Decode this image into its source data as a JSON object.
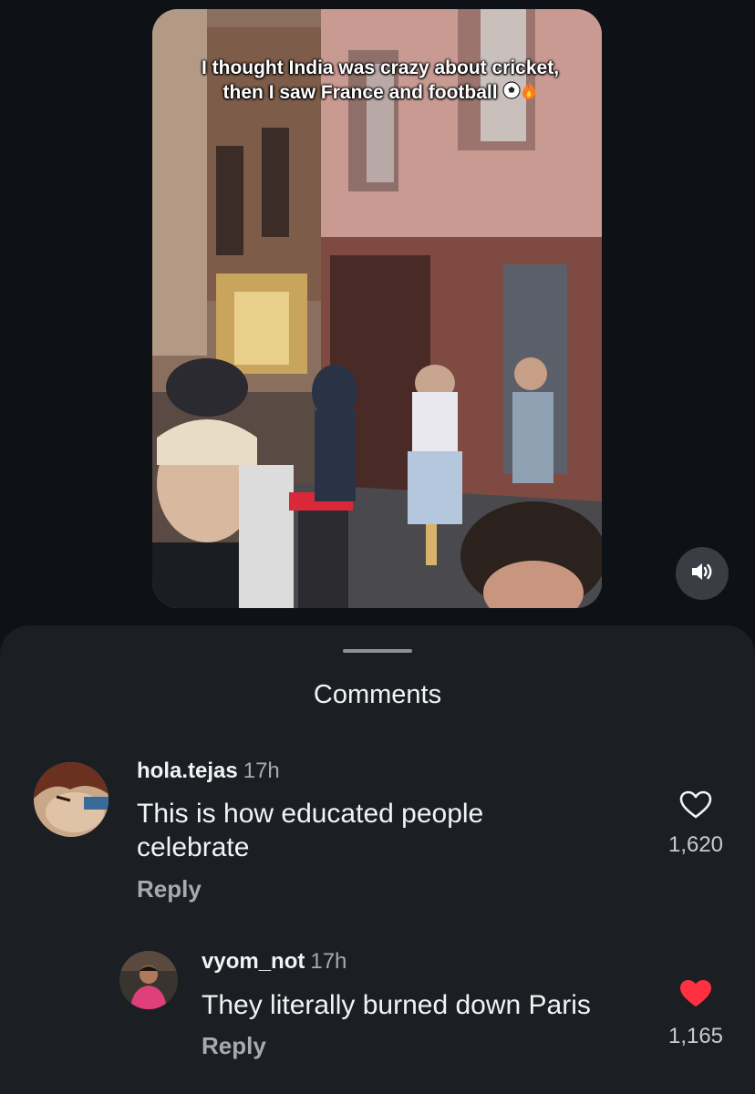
{
  "video": {
    "caption": "I thought India was crazy about cricket, then I saw France and football",
    "caption_emoji_icons": [
      "soccer-ball-icon",
      "fire-icon"
    ]
  },
  "controls": {
    "mute_icon": "speaker-icon"
  },
  "comments_sheet": {
    "title": "Comments",
    "comments": [
      {
        "username": "hola.tejas",
        "time": "17h",
        "text_line1": "This is how educated people",
        "text_line2": "celebrate",
        "reply_label": "Reply",
        "likes": "1,620",
        "liked": false
      }
    ],
    "replies": [
      {
        "username": "vyom_not",
        "time": "17h",
        "text": "They literally burned down Paris",
        "reply_label": "Reply",
        "likes": "1,165",
        "liked": true
      }
    ]
  },
  "colors": {
    "like_active": "#ff3040",
    "sheet_bg": "#1b1e23",
    "page_bg": "#0e1116"
  }
}
